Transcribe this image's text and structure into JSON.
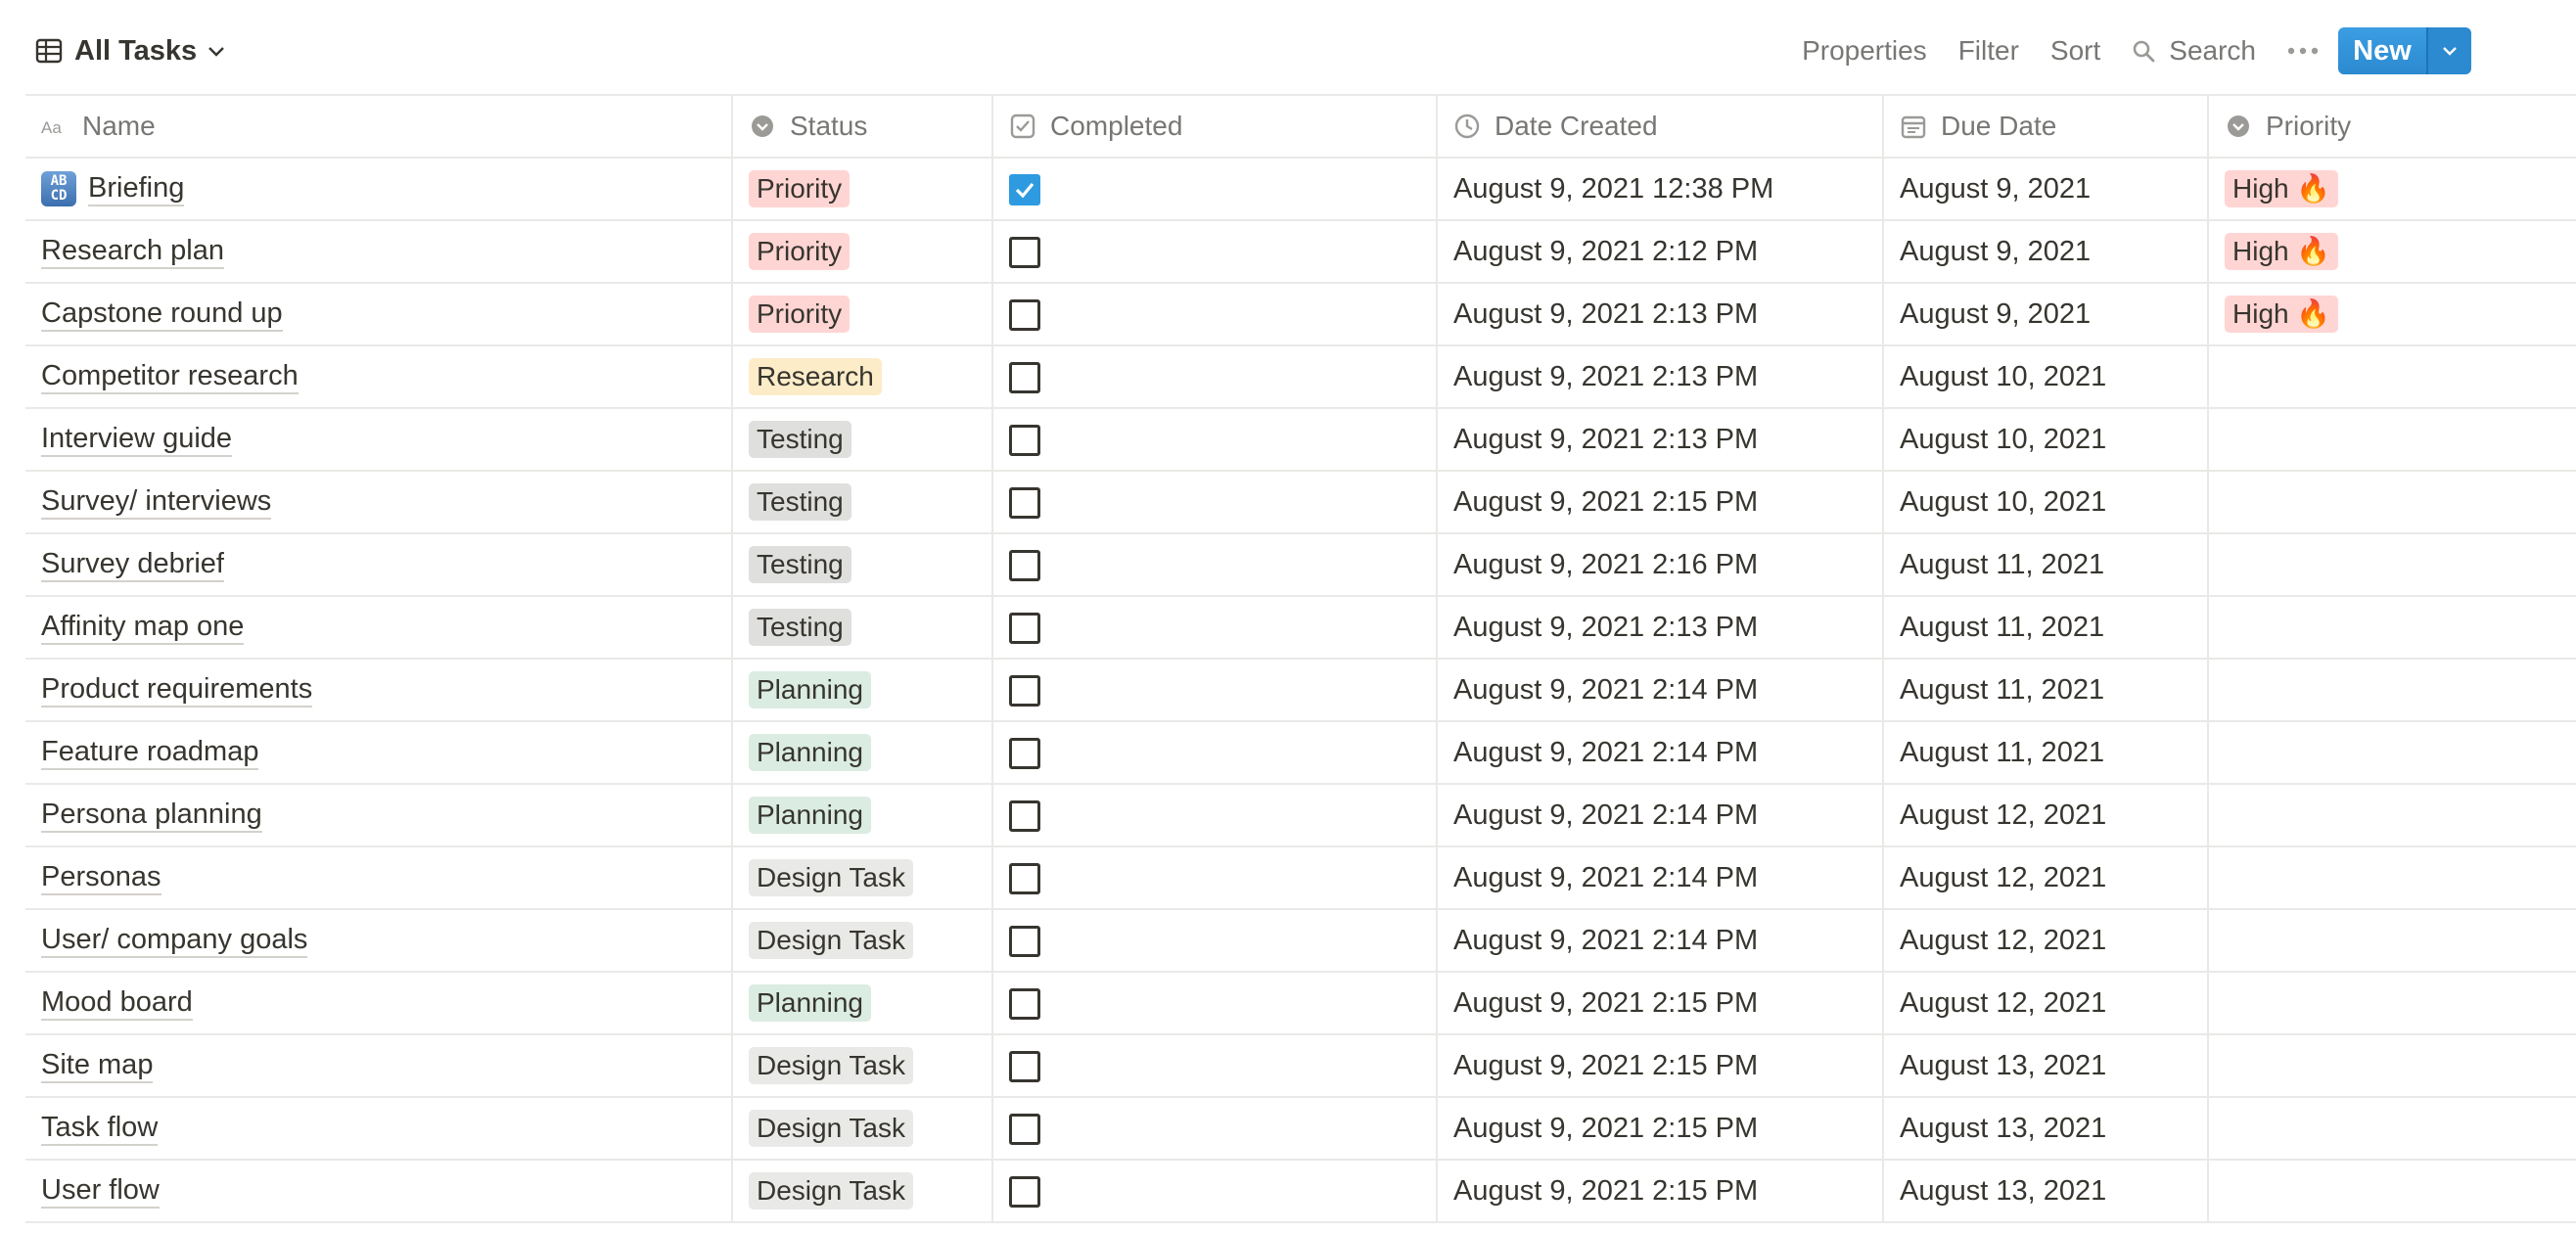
{
  "view": {
    "title": "All Tasks",
    "icon": "table-icon"
  },
  "toolbar": {
    "properties_label": "Properties",
    "filter_label": "Filter",
    "sort_label": "Sort",
    "search_label": "Search",
    "new_label": "New"
  },
  "columns": [
    {
      "label": "Name",
      "icon": "text-type-icon"
    },
    {
      "label": "Status",
      "icon": "select-icon"
    },
    {
      "label": "Completed",
      "icon": "checkbox-icon"
    },
    {
      "label": "Date Created",
      "icon": "clock-icon"
    },
    {
      "label": "Due Date",
      "icon": "calendar-icon"
    },
    {
      "label": "Priority",
      "icon": "select-icon"
    }
  ],
  "status_colors": {
    "Priority": "#ffd5d3",
    "Research": "#fdecc8",
    "Testing": "#dfdfdd",
    "Planning": "#dbece2",
    "Design Task": "#e9e9e7"
  },
  "priority_color": "#ffd5d3",
  "rows": [
    {
      "name": "Briefing",
      "icon": "abcd-icon",
      "status": "Priority",
      "completed": true,
      "created": "August 9, 2021 12:38 PM",
      "due": "August 9, 2021",
      "priority": "High 🔥"
    },
    {
      "name": "Research plan",
      "status": "Priority",
      "completed": false,
      "created": "August 9, 2021 2:12 PM",
      "due": "August 9, 2021",
      "priority": "High 🔥"
    },
    {
      "name": "Capstone round up",
      "status": "Priority",
      "completed": false,
      "created": "August 9, 2021 2:13 PM",
      "due": "August 9, 2021",
      "priority": "High 🔥"
    },
    {
      "name": "Competitor research",
      "status": "Research",
      "completed": false,
      "created": "August 9, 2021 2:13 PM",
      "due": "August 10, 2021",
      "priority": ""
    },
    {
      "name": "Interview guide",
      "status": "Testing",
      "completed": false,
      "created": "August 9, 2021 2:13 PM",
      "due": "August 10, 2021",
      "priority": ""
    },
    {
      "name": "Survey/ interviews",
      "status": "Testing",
      "completed": false,
      "created": "August 9, 2021 2:15 PM",
      "due": "August 10, 2021",
      "priority": ""
    },
    {
      "name": "Survey debrief",
      "status": "Testing",
      "completed": false,
      "created": "August 9, 2021 2:16 PM",
      "due": "August 11, 2021",
      "priority": ""
    },
    {
      "name": "Affinity map one",
      "status": "Testing",
      "completed": false,
      "created": "August 9, 2021 2:13 PM",
      "due": "August 11, 2021",
      "priority": ""
    },
    {
      "name": "Product requirements",
      "status": "Planning",
      "completed": false,
      "created": "August 9, 2021 2:14 PM",
      "due": "August 11, 2021",
      "priority": ""
    },
    {
      "name": "Feature roadmap",
      "status": "Planning",
      "completed": false,
      "created": "August 9, 2021 2:14 PM",
      "due": "August 11, 2021",
      "priority": ""
    },
    {
      "name": "Persona planning",
      "status": "Planning",
      "completed": false,
      "created": "August 9, 2021 2:14 PM",
      "due": "August 12, 2021",
      "priority": ""
    },
    {
      "name": "Personas",
      "status": "Design Task",
      "completed": false,
      "created": "August 9, 2021 2:14 PM",
      "due": "August 12, 2021",
      "priority": ""
    },
    {
      "name": "User/ company goals",
      "status": "Design Task",
      "completed": false,
      "created": "August 9, 2021 2:14 PM",
      "due": "August 12, 2021",
      "priority": ""
    },
    {
      "name": "Mood board",
      "status": "Planning",
      "completed": false,
      "created": "August 9, 2021 2:15 PM",
      "due": "August 12, 2021",
      "priority": ""
    },
    {
      "name": "Site map",
      "status": "Design Task",
      "completed": false,
      "created": "August 9, 2021 2:15 PM",
      "due": "August 13, 2021",
      "priority": ""
    },
    {
      "name": "Task flow",
      "status": "Design Task",
      "completed": false,
      "created": "August 9, 2021 2:15 PM",
      "due": "August 13, 2021",
      "priority": ""
    },
    {
      "name": "User flow",
      "status": "Design Task",
      "completed": false,
      "created": "August 9, 2021 2:15 PM",
      "due": "August 13, 2021",
      "priority": ""
    }
  ]
}
